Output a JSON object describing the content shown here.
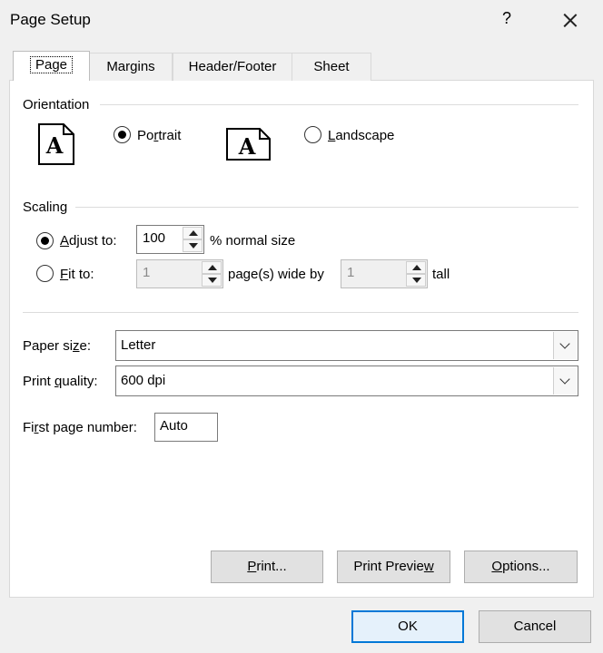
{
  "dialog": {
    "title": "Page Setup",
    "help_label": "?"
  },
  "tabs": [
    {
      "label": "Page",
      "active": true
    },
    {
      "label": "Margins",
      "active": false
    },
    {
      "label": "Header/Footer",
      "active": false
    },
    {
      "label": "Sheet",
      "active": false
    }
  ],
  "orientation": {
    "group_label": "Orientation",
    "portrait": {
      "label_pre": "Po",
      "label_u": "r",
      "label_post": "trait",
      "selected": true,
      "icon_glyph": "A"
    },
    "landscape": {
      "label_pre": "",
      "label_u": "L",
      "label_post": "andscape",
      "selected": false,
      "icon_glyph": "A"
    }
  },
  "scaling": {
    "group_label": "Scaling",
    "adjust_to": {
      "label_pre": "",
      "label_u": "A",
      "label_post": "djust to:",
      "selected": true,
      "value": "100",
      "suffix": "% normal size"
    },
    "fit_to": {
      "label_pre": "",
      "label_u": "F",
      "label_post": "it to:",
      "selected": false,
      "wide_value": "1",
      "wide_suffix": "page(s) wide by",
      "tall_value": "1",
      "tall_suffix": "tall"
    }
  },
  "paper_size": {
    "label_pre": "Paper si",
    "label_u": "z",
    "label_post": "e:",
    "value": "Letter"
  },
  "print_quality": {
    "label_pre": "Print ",
    "label_u": "q",
    "label_post": "uality:",
    "value": "600 dpi"
  },
  "first_page_number": {
    "label_pre": "Fi",
    "label_u": "r",
    "label_post": "st page number:",
    "value": "Auto"
  },
  "buttons": {
    "print": {
      "pre": "",
      "u": "P",
      "post": "rint..."
    },
    "print_preview": {
      "pre": "Print Previe",
      "u": "w",
      "post": ""
    },
    "options": {
      "pre": "",
      "u": "O",
      "post": "ptions..."
    },
    "ok": "OK",
    "cancel": "Cancel"
  },
  "colors": {
    "accent": "#0078d7",
    "window_bg": "#f0f0f0",
    "panel_bg": "#ffffff"
  }
}
